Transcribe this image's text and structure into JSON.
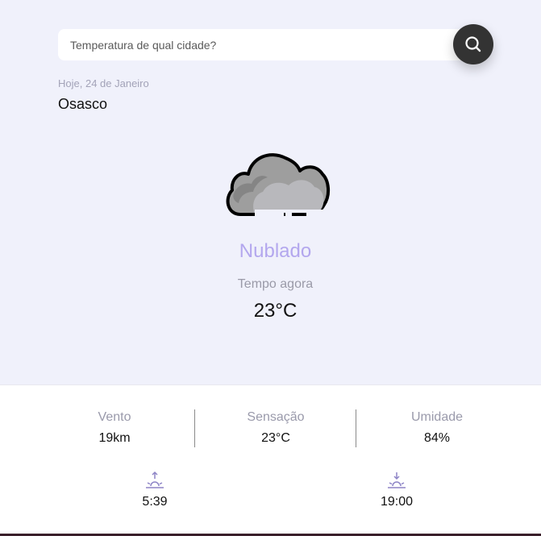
{
  "search": {
    "placeholder": "Temperatura de qual cidade?"
  },
  "location": {
    "date": "Hoje, 24 de Janeiro",
    "city": "Osasco"
  },
  "current": {
    "icon": "cloud-icon",
    "condition": "Nublado",
    "label": "Tempo agora",
    "temperature": "23°C"
  },
  "details": {
    "wind": {
      "label": "Vento",
      "value": "19km"
    },
    "feels_like": {
      "label": "Sensação",
      "value": "23°C"
    },
    "humidity": {
      "label": "Umidade",
      "value": "84%"
    }
  },
  "sun": {
    "sunrise": {
      "icon": "sunrise-icon",
      "time": "5:39"
    },
    "sunset": {
      "icon": "sunset-icon",
      "time": "19:00"
    }
  },
  "colors": {
    "accent": "#b3a7ee",
    "background": "#f0f1fb",
    "search_button": "#333333",
    "sun_icon": "#8d84c6"
  }
}
